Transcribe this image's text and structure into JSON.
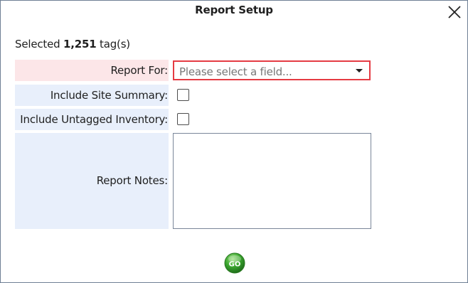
{
  "dialog": {
    "title": "Report Setup",
    "close_icon": "close-icon"
  },
  "selection": {
    "prefix": "Selected",
    "count": "1,251",
    "suffix": "tag(s)"
  },
  "fields": {
    "report_for": {
      "label": "Report For:",
      "placeholder": "Please select a field...",
      "required": true,
      "icon": "chevron-down-icon"
    },
    "include_site_summary": {
      "label": "Include Site Summary:",
      "checked": false
    },
    "include_untagged_inventory": {
      "label": "Include Untagged Inventory:",
      "checked": false
    },
    "report_notes": {
      "label": "Report Notes:",
      "value": ""
    }
  },
  "actions": {
    "go_label": "GO"
  },
  "colors": {
    "required_bg": "#fce6e8",
    "label_bg": "#e8effb",
    "required_border": "#e53b43",
    "go_green": "#3aa52e"
  }
}
